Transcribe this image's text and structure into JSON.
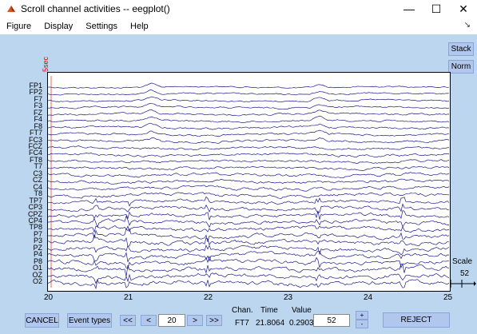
{
  "window": {
    "title": "Scroll channel activities -- eegplot()",
    "minimize": "—",
    "maximize": "☐",
    "close": "✕"
  },
  "menu": {
    "items": [
      "Figure",
      "Display",
      "Settings",
      "Help"
    ],
    "dock_arrow": "↘"
  },
  "side_buttons": {
    "stack": "Stack",
    "norm": "Norm"
  },
  "plot": {
    "time_marker": "5sec",
    "channels": [
      "FP1",
      "FP2",
      "F7",
      "F3",
      "FZ",
      "F4",
      "F8",
      "FT7",
      "FC3",
      "FCZ",
      "FC4",
      "FT8",
      "T7",
      "C3",
      "CZ",
      "C4",
      "T8",
      "TP7",
      "CP3",
      "CPZ",
      "CP4",
      "TP8",
      "P7",
      "P3",
      "PZ",
      "P4",
      "P8",
      "O1",
      "OZ",
      "O2"
    ],
    "x_ticks": [
      "20",
      "21",
      "22",
      "23",
      "24",
      "25"
    ],
    "trace_color": "#1a1a8c",
    "scale_title": "Scale",
    "scale_value": "52"
  },
  "controls": {
    "cancel": "CANCEL",
    "event_types": "Event types",
    "prev_page": "<<",
    "prev": "<",
    "position": "20",
    "next": ">",
    "next_page": ">>",
    "chan_header": "Chan.",
    "time_header": "Time",
    "value_header": "Value",
    "chan_value": "FT7",
    "time_value": "21.8064",
    "value_value": "0.2903",
    "scale_input": "52",
    "scale_up": "+",
    "scale_down": "-",
    "reject": "REJECT"
  }
}
